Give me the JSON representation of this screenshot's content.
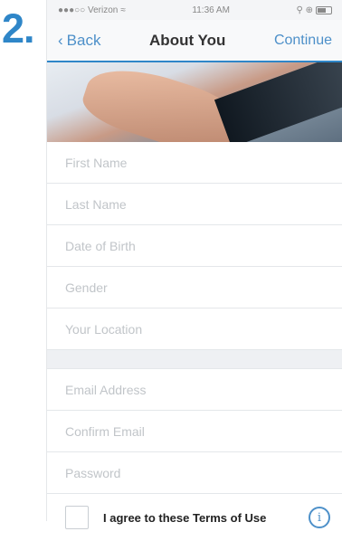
{
  "step_number": "2.",
  "status_bar": {
    "carrier": "●●●○○ Verizon",
    "time": "11:36 AM",
    "right": "⚲ ⊕"
  },
  "nav": {
    "back_label": "Back",
    "title": "About You",
    "continue_label": "Continue"
  },
  "form": {
    "group1": [
      {
        "placeholder": "First Name"
      },
      {
        "placeholder": "Last Name"
      },
      {
        "placeholder": "Date of Birth"
      },
      {
        "placeholder": "Gender"
      },
      {
        "placeholder": "Your Location"
      }
    ],
    "group2": [
      {
        "placeholder": "Email Address"
      },
      {
        "placeholder": "Confirm Email"
      },
      {
        "placeholder": "Password"
      }
    ],
    "terms_label": "I agree to these Terms of Use"
  },
  "icons": {
    "back": "chevron-left-icon",
    "wifi": "wifi-icon",
    "battery": "battery-icon",
    "info": "info-icon"
  },
  "colors": {
    "accent": "#4d90c9",
    "step": "#2f86c8"
  }
}
